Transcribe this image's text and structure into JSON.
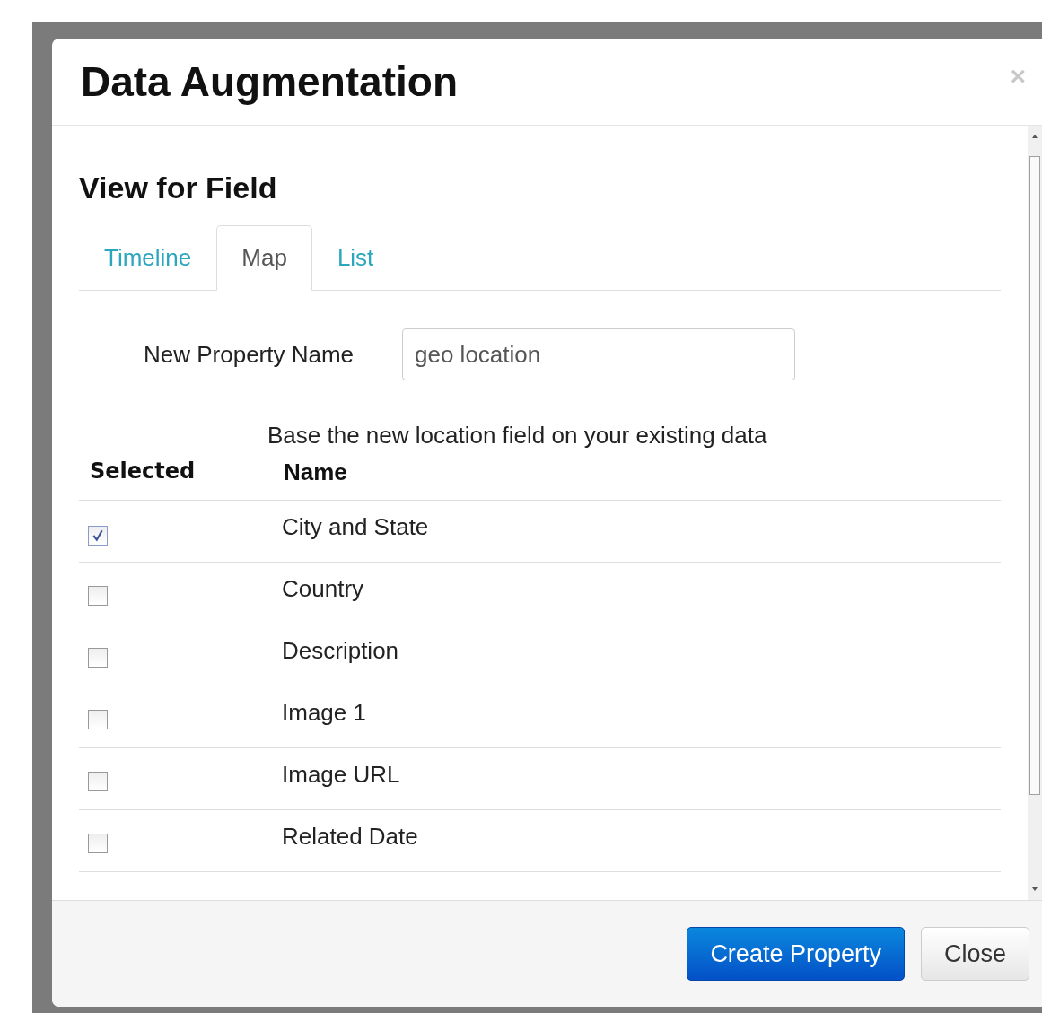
{
  "dialog": {
    "title": "Data Augmentation",
    "close_icon": "×"
  },
  "section": {
    "title": "View for Field"
  },
  "tabs": [
    {
      "label": "Timeline",
      "selected": false
    },
    {
      "label": "Map",
      "selected": true
    },
    {
      "label": "List",
      "selected": false
    }
  ],
  "property": {
    "label": "New Property Name",
    "value": "geo location"
  },
  "description": "Base the new location field on your existing data",
  "table": {
    "columns": [
      "Selected",
      "Name"
    ],
    "rows": [
      {
        "name": "City and State",
        "checked": true
      },
      {
        "name": "Country",
        "checked": false
      },
      {
        "name": "Description",
        "checked": false
      },
      {
        "name": "Image 1",
        "checked": false
      },
      {
        "name": "Image URL",
        "checked": false
      },
      {
        "name": "Related Date",
        "checked": false
      }
    ]
  },
  "buttons": [
    {
      "label": "Create Property",
      "kind": "primary"
    },
    {
      "label": "Close",
      "kind": "default"
    }
  ]
}
